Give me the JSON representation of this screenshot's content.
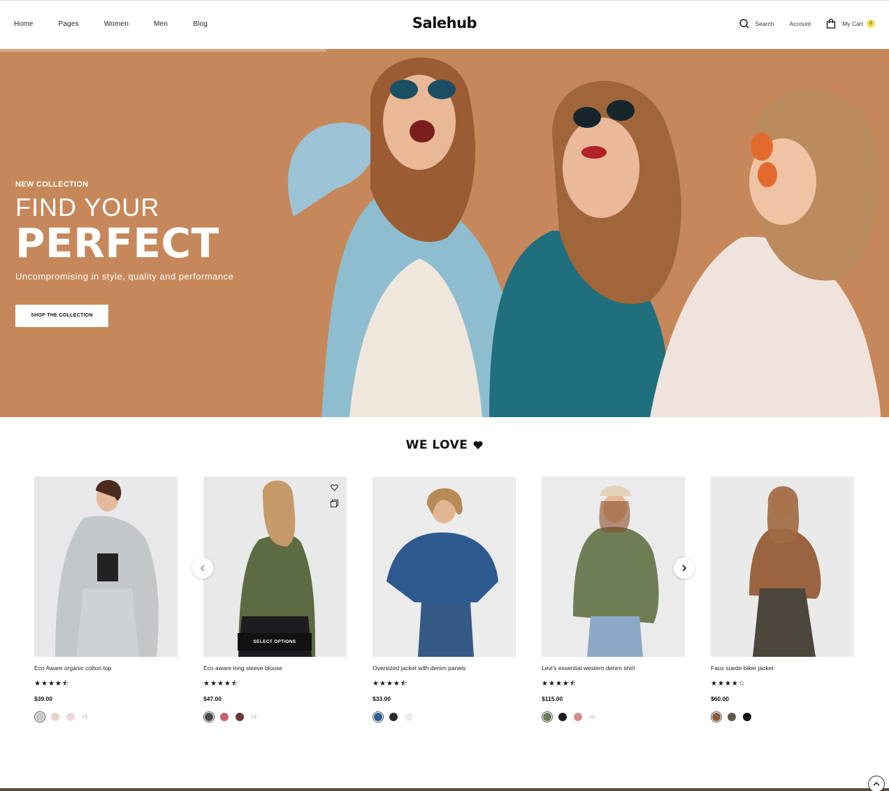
{
  "header": {
    "nav": [
      "Home",
      "Pages",
      "Women",
      "Men",
      "Blog"
    ],
    "logo": "Salehub",
    "search_label": "Search",
    "account_label": "Account",
    "cart_label": "My Cart",
    "cart_count": "0"
  },
  "hero": {
    "eyebrow": "NEW COLLECTION",
    "title_line1": "FIND YOUR",
    "title_line2": "PERFECT",
    "subtitle": "Uncompromising in style, quality and performance",
    "cta": "SHOP THE COLLECTION",
    "bg_color": "#c6885a"
  },
  "section": {
    "title": "WE LOVE",
    "select_options": "SELECT OPTIONS"
  },
  "products": [
    {
      "name": "Eco Aware organic cotton top",
      "rating": 4.5,
      "price": "$39.00",
      "swatches": [
        "#c9c9c9",
        "#e8d3c8",
        "#f1d7e0"
      ],
      "more": "+3"
    },
    {
      "name": "Eco aware long sleeve blouse",
      "rating": 4.5,
      "price": "$47.00",
      "swatches": [
        "#4b4b4b",
        "#c7616f",
        "#6b3a32"
      ],
      "more": "+2"
    },
    {
      "name": "Oversized jacket with denim panels",
      "rating": 4.5,
      "price": "$33.00",
      "swatches": [
        "#335d97",
        "#2b2b2b",
        "#eeeeee"
      ],
      "more": ""
    },
    {
      "name": "Levi's essential western denim shirt",
      "rating": 4.5,
      "price": "$115.00",
      "swatches": [
        "#6e7a54",
        "#1f1f1f",
        "#d98b92"
      ],
      "more": "+2"
    },
    {
      "name": "Faux suede biker jacket",
      "rating": 4,
      "price": "$60.00",
      "swatches": [
        "#8a5a3a",
        "#5e5a47",
        "#111111"
      ],
      "more": ""
    }
  ]
}
